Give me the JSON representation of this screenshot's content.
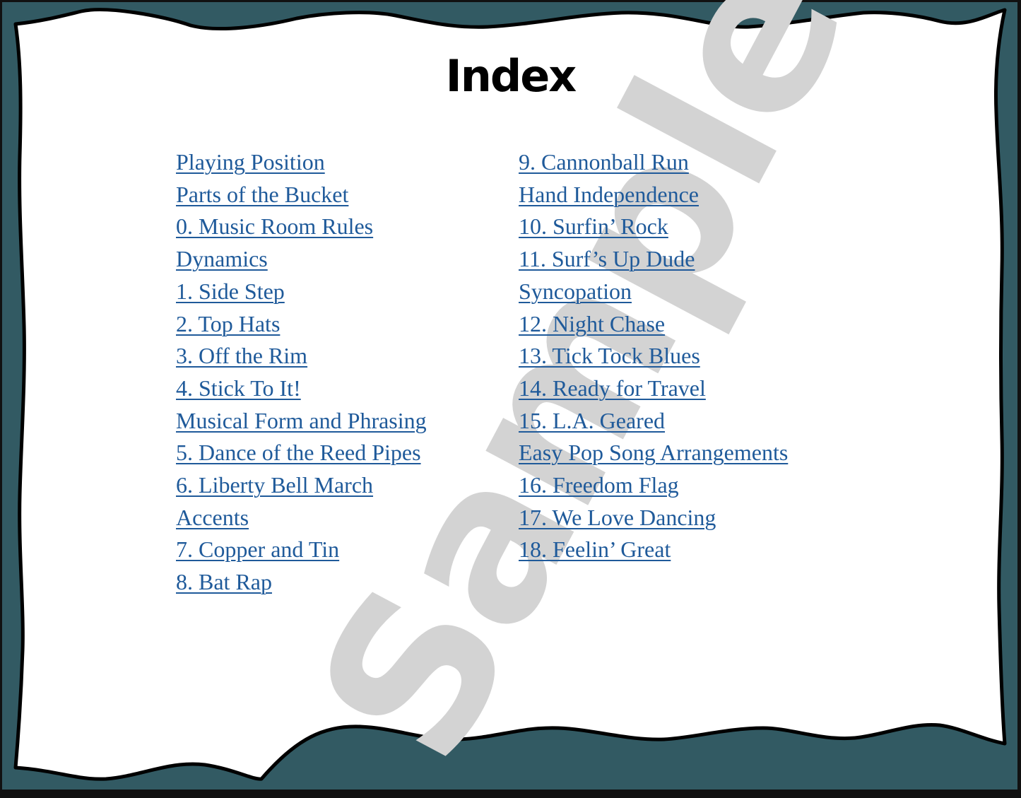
{
  "page": {
    "title": "Index",
    "watermark": "Sample",
    "colors": {
      "frame": "#325a63",
      "link": "#1f5a9a",
      "watermark": "#d3d3d3",
      "panel": "#ffffff"
    }
  },
  "index": {
    "left_column": [
      "Playing Position",
      "Parts of the Bucket",
      "0. Music Room Rules",
      "Dynamics",
      "1. Side Step",
      "2. Top Hats",
      "3. Off the Rim",
      "4. Stick To It!",
      "Musical Form and Phrasing",
      "5. Dance of the Reed Pipes",
      "6. Liberty Bell March",
      "Accents",
      "7. Copper and Tin",
      "8. Bat Rap"
    ],
    "right_column": [
      "9. Cannonball Run",
      "Hand Independence",
      "10. Surfin’ Rock",
      "11. Surf’s Up Dude",
      "Syncopation",
      "12. Night Chase",
      "13. Tick Tock Blues",
      "14. Ready for Travel",
      "15. L.A. Geared",
      "Easy Pop Song Arrangements",
      "16. Freedom Flag",
      "17. We Love Dancing",
      "18. Feelin’ Great"
    ]
  }
}
